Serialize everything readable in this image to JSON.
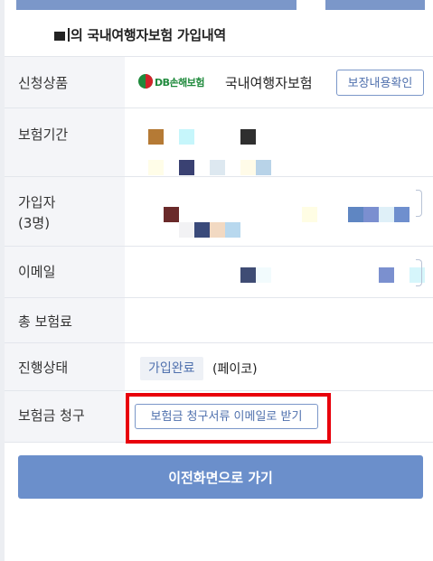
{
  "header": {
    "title": "의 국내여행자보험 가입내역"
  },
  "rows": {
    "product": {
      "label": "신청상품",
      "insurer_logo_text": "DB손해보험",
      "product_name": "국내여행자보험",
      "coverage_button": "보장내용확인"
    },
    "period": {
      "label": "보험기간"
    },
    "insured": {
      "label_line1": "가입자",
      "label_line2": "(3명)"
    },
    "email": {
      "label": "이메일"
    },
    "premium": {
      "label": "총 보험료"
    },
    "status": {
      "label": "진행상태",
      "value": "가입완료",
      "payment": "(페이코)"
    },
    "claim": {
      "label": "보험금 청구",
      "button": "보험금 청구서류 이메일로 받기"
    }
  },
  "footer": {
    "back_button": "이전화면으로 가기"
  },
  "colors": {
    "accent": "#6b8fcb",
    "highlight": "#e8000b",
    "brand_green": "#1f8a3c",
    "brand_red": "#d2232a"
  }
}
